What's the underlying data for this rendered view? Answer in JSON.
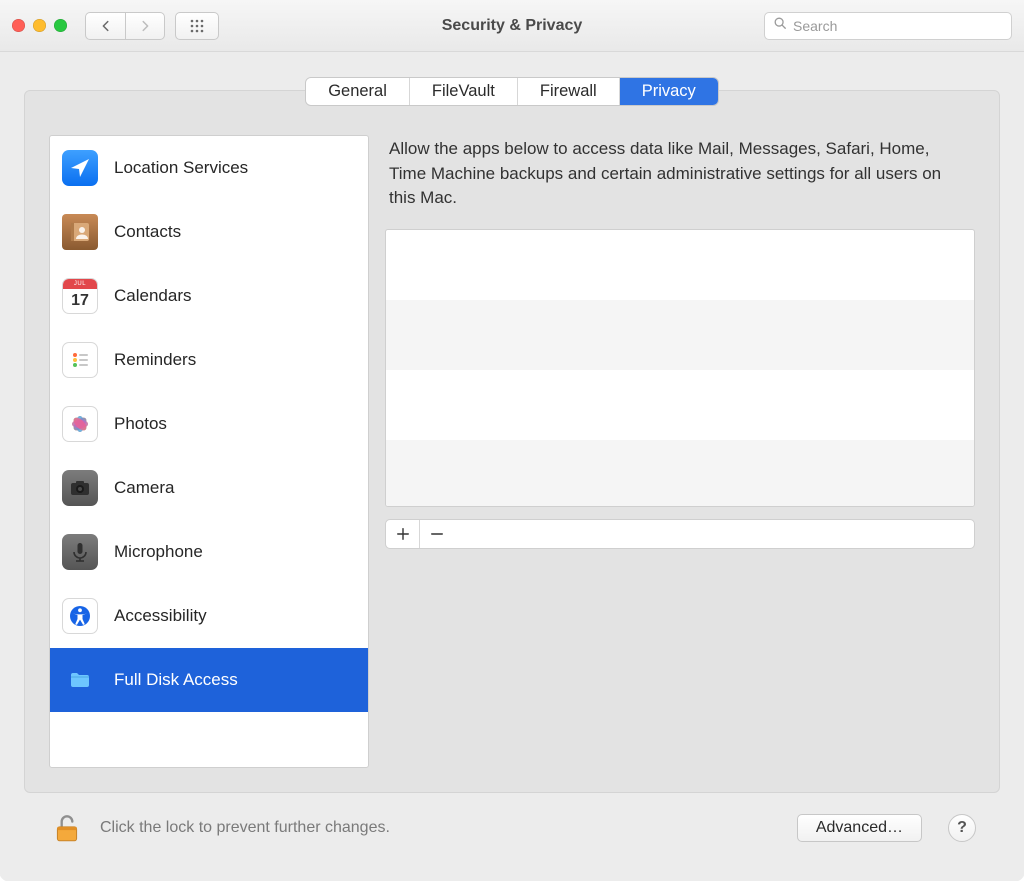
{
  "window": {
    "title": "Security & Privacy"
  },
  "toolbar": {
    "search_placeholder": "Search"
  },
  "tabs": {
    "items": [
      "General",
      "FileVault",
      "Firewall",
      "Privacy"
    ],
    "active": 3
  },
  "sidebar": {
    "items": [
      {
        "label": "Location Services",
        "icon": "location"
      },
      {
        "label": "Contacts",
        "icon": "contacts"
      },
      {
        "label": "Calendars",
        "icon": "calendar"
      },
      {
        "label": "Reminders",
        "icon": "reminders"
      },
      {
        "label": "Photos",
        "icon": "photos"
      },
      {
        "label": "Camera",
        "icon": "camera"
      },
      {
        "label": "Microphone",
        "icon": "microphone"
      },
      {
        "label": "Accessibility",
        "icon": "accessibility"
      },
      {
        "label": "Full Disk Access",
        "icon": "folder",
        "selected": true
      }
    ]
  },
  "calendar_icon": {
    "month": "JUL",
    "day": "17"
  },
  "main": {
    "description": "Allow the apps below to access data like Mail, Messages, Safari, Home, Time Machine backups and certain administrative settings for all users on this Mac."
  },
  "footer": {
    "lock_text": "Click the lock to prevent further changes.",
    "advanced_label": "Advanced…",
    "help_label": "?"
  }
}
